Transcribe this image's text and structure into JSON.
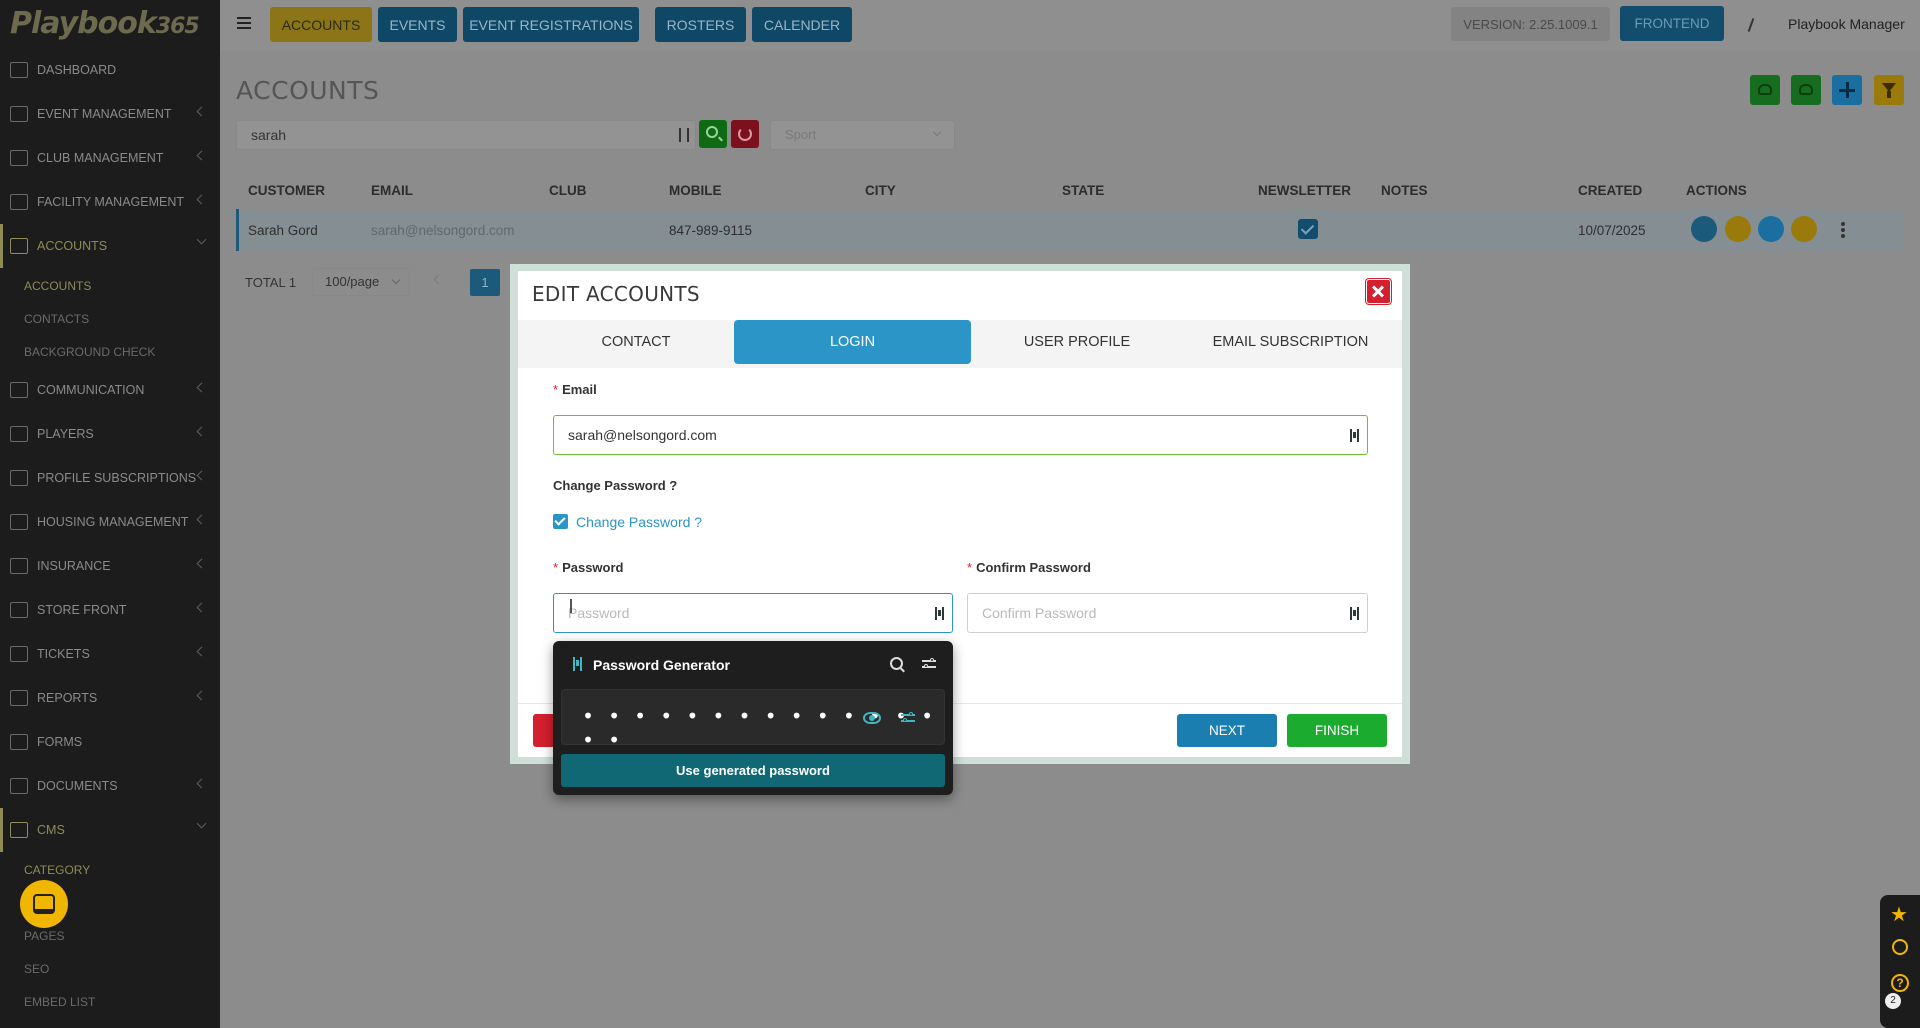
{
  "logo": {
    "text": "Playbook",
    "num": "365"
  },
  "sidebar": {
    "items": [
      {
        "label": "DASHBOARD",
        "icon": "dashboard-icon",
        "chevron": false
      },
      {
        "label": "EVENT MANAGEMENT",
        "icon": "calendar-icon",
        "chevron": true
      },
      {
        "label": "CLUB MANAGEMENT",
        "icon": "club-icon",
        "chevron": true
      },
      {
        "label": "FACILITY MANAGEMENT",
        "icon": "facility-icon",
        "chevron": true
      },
      {
        "label": "ACCOUNTS",
        "icon": "accounts-icon",
        "chevron": true,
        "expanded": true
      },
      {
        "label": "COMMUNICATION",
        "icon": "chat-icon",
        "chevron": true
      },
      {
        "label": "PLAYERS",
        "icon": "players-icon",
        "chevron": true
      },
      {
        "label": "PROFILE SUBSCRIPTIONS",
        "icon": "subscriptions-icon",
        "chevron": true
      },
      {
        "label": "HOUSING MANAGEMENT",
        "icon": "housing-icon",
        "chevron": true
      },
      {
        "label": "INSURANCE",
        "icon": "insurance-icon",
        "chevron": true
      },
      {
        "label": "STORE FRONT",
        "icon": "cart-icon",
        "chevron": true
      },
      {
        "label": "TICKETS",
        "icon": "ticket-icon",
        "chevron": true
      },
      {
        "label": "REPORTS",
        "icon": "reports-icon",
        "chevron": true
      },
      {
        "label": "FORMS",
        "icon": "forms-icon",
        "chevron": false
      },
      {
        "label": "DOCUMENTS",
        "icon": "folder-icon",
        "chevron": true
      },
      {
        "label": "CMS",
        "icon": "cms-icon",
        "chevron": true,
        "expanded": true
      }
    ],
    "accounts_sub": [
      "ACCOUNTS",
      "CONTACTS",
      "BACKGROUND CHECK"
    ],
    "cms_sub": [
      "CATEGORY",
      "PAGES",
      "SEO",
      "EMBED LIST"
    ]
  },
  "topbar": {
    "tabs": [
      "ACCOUNTS",
      "EVENTS",
      "EVENT REGISTRATIONS",
      "ROSTERS",
      "CALENDER"
    ],
    "version": "VERSION: 2.25.1009.1",
    "frontend": "FRONTEND",
    "user": "Playbook Manager"
  },
  "page": {
    "title": "ACCOUNTS",
    "search_value": "sarah",
    "sport_placeholder": "Sport"
  },
  "table": {
    "headers": [
      "CUSTOMER",
      "EMAIL",
      "CLUB",
      "MOBILE",
      "CITY",
      "STATE",
      "NEWSLETTER",
      "NOTES",
      "CREATED",
      "ACTIONS"
    ],
    "rows": [
      {
        "customer": "Sarah Gord",
        "email": "sarah@nelsongord.com",
        "club": "",
        "mobile": "847-989-9115",
        "city": "",
        "state": "",
        "newsletter": true,
        "notes": "",
        "created": "10/07/2025"
      }
    ],
    "total": "TOTAL 1",
    "page_size": "100/page",
    "page": "1"
  },
  "modal": {
    "title": "EDIT ACCOUNTS",
    "tabs": [
      "CONTACT",
      "LOGIN",
      "USER PROFILE",
      "EMAIL SUBSCRIPTION"
    ],
    "active_tab": "LOGIN",
    "email_label": "Email",
    "email_value": "sarah@nelsongord.com",
    "change_pw_heading": "Change Password ?",
    "change_pw_checkbox": "Change Password ?",
    "password_label": "Password",
    "password_placeholder": "Password",
    "confirm_label": "Confirm Password",
    "confirm_placeholder": "Confirm Password",
    "next": "NEXT",
    "finish": "FINISH"
  },
  "pwgen": {
    "title": "Password Generator",
    "masked": "• • • • • • • • • • • • • • • •",
    "use_button": "Use generated password"
  },
  "floatbar": {
    "help_badge": "2"
  },
  "colors": {
    "primary": "#2c95c8",
    "finish": "#1aab2f",
    "danger": "#d4202e",
    "accent": "#f1b700",
    "pwgen_teal": "#0f6873"
  }
}
